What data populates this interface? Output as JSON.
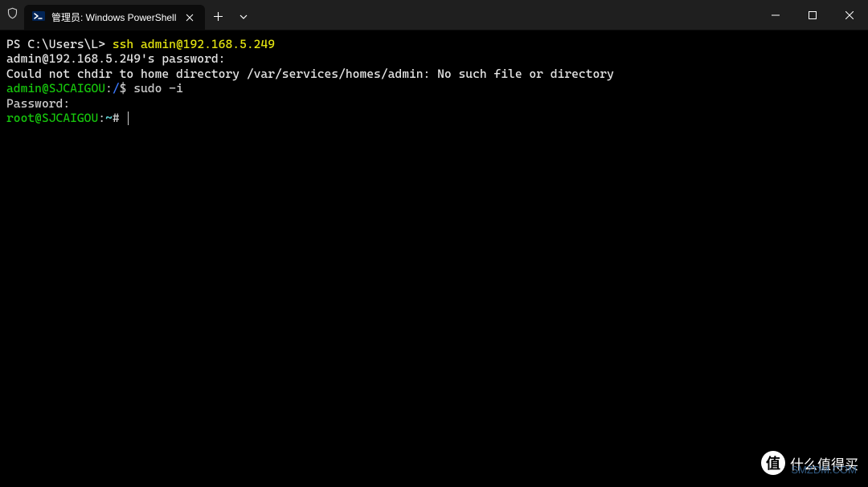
{
  "titlebar": {
    "tab_title": "管理员: Windows PowerShell"
  },
  "terminal": {
    "line1_prompt": "PS C:\\Users\\L> ",
    "line1_cmd": "ssh admin@192.168.5.249",
    "line2": "admin@192.168.5.249's password:",
    "line3": "Could not chdir to home directory /var/services/homes/admin: No such file or directory",
    "line4_user": "admin@SJCAIGOU",
    "line4_colon": ":",
    "line4_path": "/",
    "line4_dollar": "$ ",
    "line4_cmd": "sudo -i",
    "line5": "Password:",
    "line6_user": "root@SJCAIGOU",
    "line6_colon": ":",
    "line6_path": "~",
    "line6_hash": "# "
  },
  "watermark": {
    "badge": "值",
    "text": "什么值得买",
    "sub": "SMZDM.COM"
  }
}
